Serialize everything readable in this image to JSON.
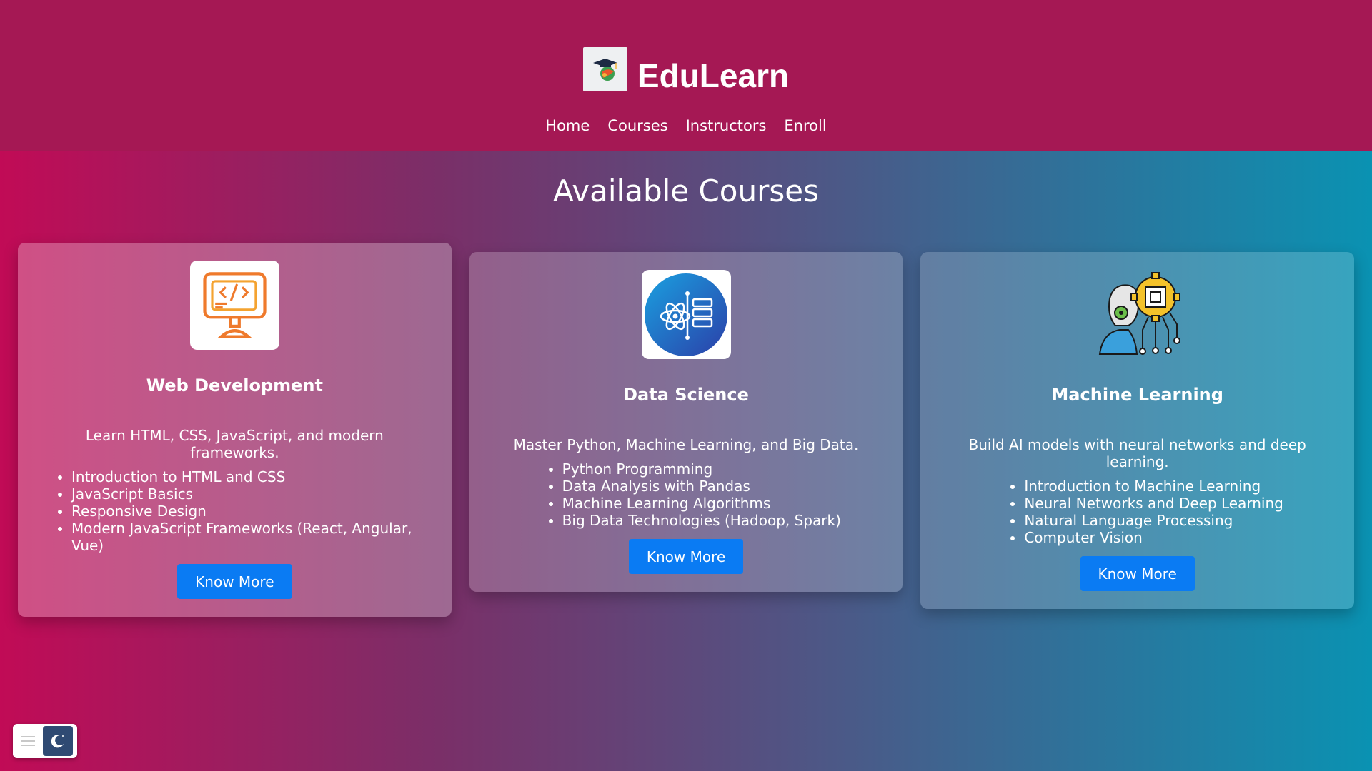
{
  "brand": {
    "title": "EduLearn"
  },
  "nav": [
    "Home",
    "Courses",
    "Instructors",
    "Enroll"
  ],
  "section_title": "Available Courses",
  "courses": [
    {
      "title": "Web Development",
      "description": "Learn HTML, CSS, JavaScript, and modern frameworks.",
      "topics": [
        "Introduction to HTML and CSS",
        "JavaScript Basics",
        "Responsive Design",
        "Modern JavaScript Frameworks (React, Angular, Vue)"
      ],
      "button": "Know More",
      "icon": "code-monitor-icon"
    },
    {
      "title": "Data Science",
      "description": "Master Python, Machine Learning, and Big Data.",
      "topics": [
        "Python Programming",
        "Data Analysis with Pandas",
        "Machine Learning Algorithms",
        "Big Data Technologies (Hadoop, Spark)"
      ],
      "button": "Know More",
      "icon": "atom-data-icon"
    },
    {
      "title": "Machine Learning",
      "description": "Build AI models with neural networks and deep learning.",
      "topics": [
        "Introduction to Machine Learning",
        "Neural Networks and Deep Learning",
        "Natural Language Processing",
        "Computer Vision"
      ],
      "button": "Know More",
      "icon": "ai-brain-chip-icon"
    }
  ],
  "colors": {
    "header": "#a51854",
    "button": "#0a7bf3"
  }
}
